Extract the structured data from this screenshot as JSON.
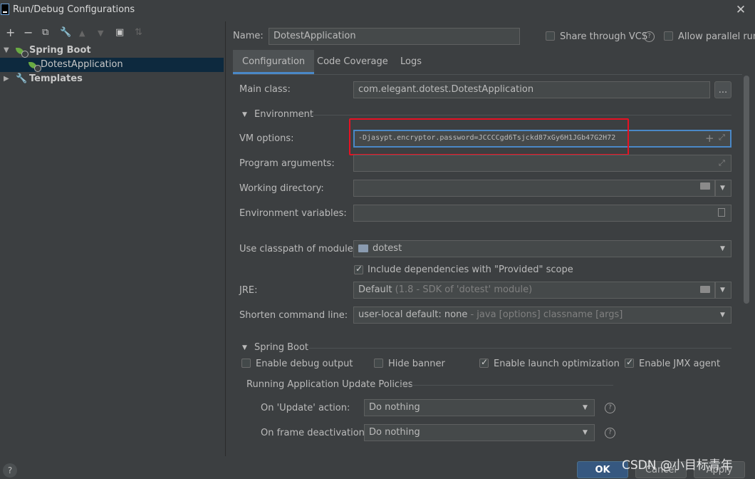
{
  "window": {
    "title": "Run/Debug Configurations",
    "close": "✕"
  },
  "left_toolbar": {
    "add": "+",
    "remove": "−",
    "copy": "⧉",
    "edit": "🔧",
    "up": "▲",
    "down": "▼",
    "folder": "▣",
    "sort": "⇅"
  },
  "tree": {
    "spring_boot": "Spring Boot",
    "dotest_app": "DotestApplication",
    "templates": "Templates"
  },
  "header": {
    "name_label": "Name:",
    "name_value": "DotestApplication",
    "share_vcs": "Share through VCS",
    "allow_parallel": "Allow parallel run"
  },
  "tabs": [
    "Configuration",
    "Code Coverage",
    "Logs"
  ],
  "form": {
    "main_class_label": "Main class:",
    "main_class_value": "com.elegant.dotest.DotestApplication",
    "browse_button": "...",
    "environment_header": "Environment",
    "vm_options_label": "VM options:",
    "vm_options_value": "-Djasypt.encryptor.password=JCCCCgd6Tsjckd87xGy6H1JGb47G2H72",
    "program_args_label": "Program arguments:",
    "working_dir_label": "Working directory:",
    "env_vars_label": "Environment variables:",
    "classpath_label": "Use classpath of module:",
    "classpath_value": "dotest",
    "include_deps": "Include dependencies with \"Provided\" scope",
    "jre_label": "JRE:",
    "jre_value": "Default",
    "jre_hint": "(1.8 - SDK of 'dotest' module)",
    "shorten_label": "Shorten command line:",
    "shorten_value": "user-local default: none",
    "shorten_hint": "- java [options] classname [args]"
  },
  "spring_boot": {
    "header": "Spring Boot",
    "debug_output": "Enable debug output",
    "hide_banner": "Hide banner",
    "launch_opt": "Enable launch optimization",
    "jmx_agent": "Enable JMX agent",
    "policies_header": "Running Application Update Policies",
    "on_update_label": "On 'Update' action:",
    "on_update_value": "Do nothing",
    "on_frame_label": "On frame deactivation:",
    "on_frame_value": "Do nothing"
  },
  "footer": {
    "help": "?",
    "ok": "OK",
    "cancel": "Cancel",
    "apply": "Apply"
  },
  "watermark": "CSDN @小目标青年"
}
